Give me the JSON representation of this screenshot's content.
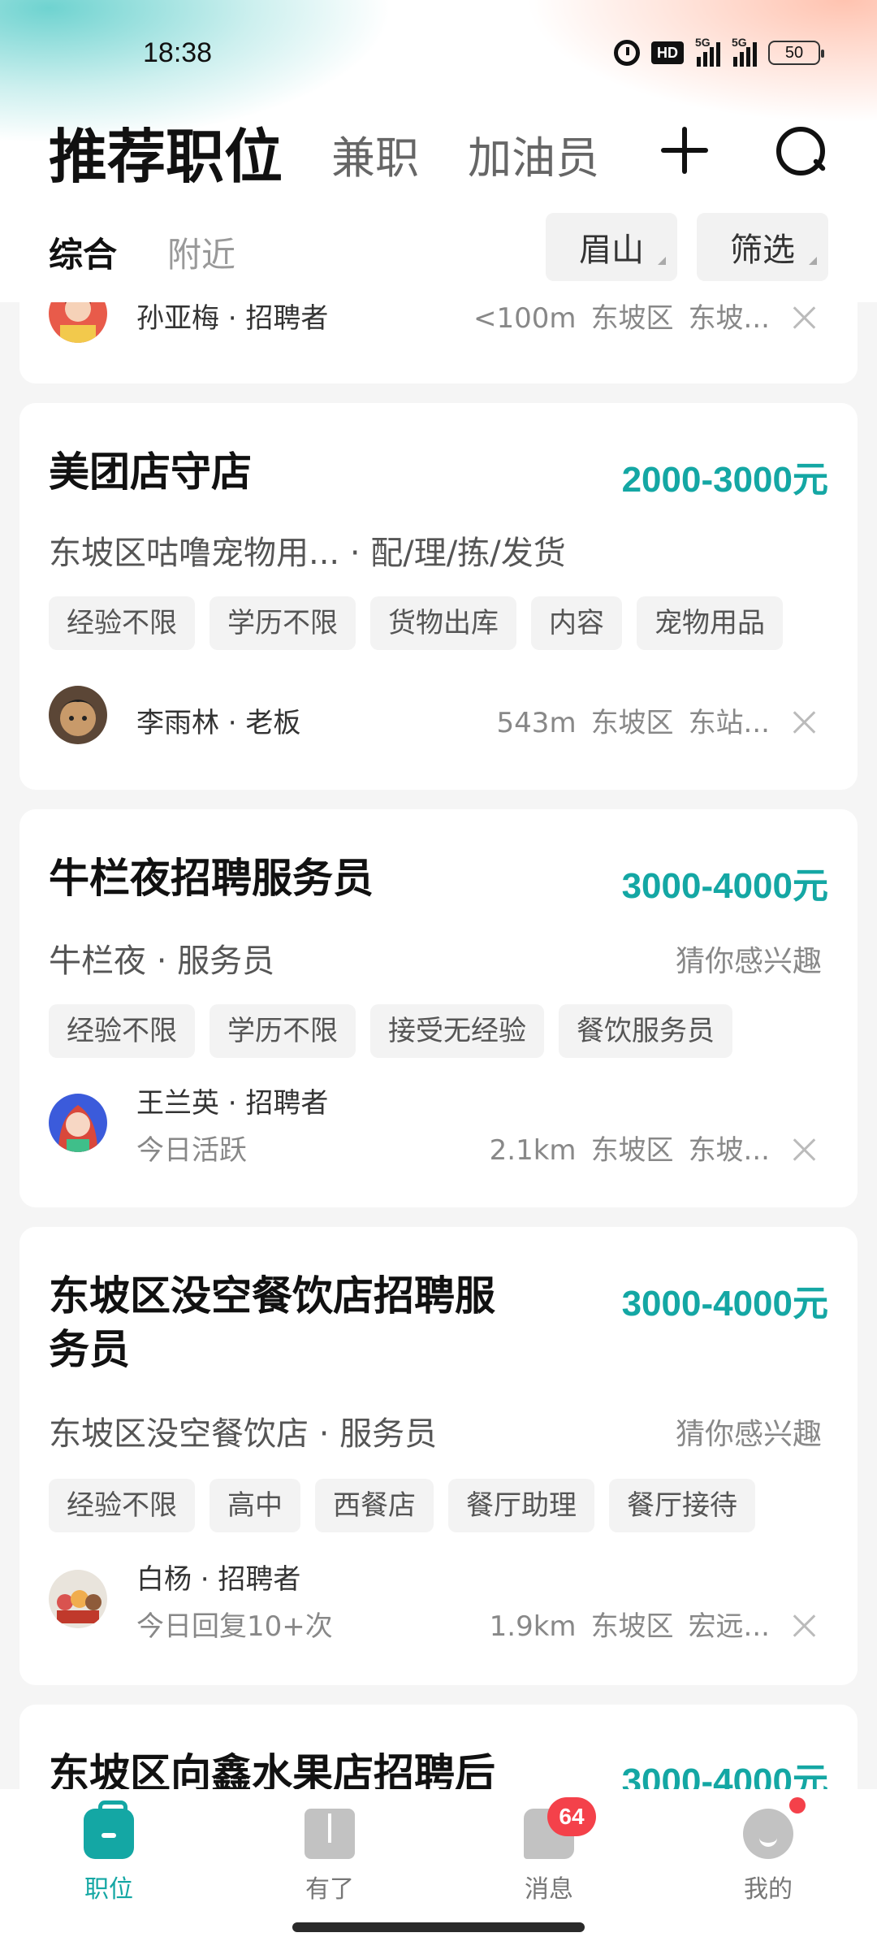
{
  "status_bar": {
    "time": "18:38",
    "icons": [
      "alarm-icon",
      "hd-icon",
      "signal-5g-icon",
      "signal-5g-icon",
      "battery-icon"
    ],
    "hd_label": "HD",
    "net_label": "5G",
    "battery": "50"
  },
  "header": {
    "title": "推荐职位",
    "tabs": [
      "兼职",
      "加油员"
    ],
    "add_icon": "plus-icon",
    "search_icon": "search-icon"
  },
  "filter_bar": {
    "sort_active": "综合",
    "sort_other": "附近",
    "city": "眉山",
    "filter": "筛选"
  },
  "jobs": [
    {
      "recruiter": "孙亚梅 · 招聘者",
      "distance": "<100m",
      "district": "东坡区",
      "area": "东坡..."
    },
    {
      "title": "美团店守店",
      "salary": "2000-3000元",
      "company": "东坡区咕噜宠物用... · 配/理/拣/发货",
      "tags": [
        "经验不限",
        "学历不限",
        "货物出库",
        "内容",
        "宠物用品"
      ],
      "recruiter": "李雨林 · 老板",
      "distance": "543m",
      "district": "东坡区",
      "area": "东站..."
    },
    {
      "title": "牛栏夜招聘服务员",
      "salary": "3000-4000元",
      "company": "牛栏夜 · 服务员",
      "hint": "猜你感兴趣",
      "tags": [
        "经验不限",
        "学历不限",
        "接受无经验",
        "餐饮服务员"
      ],
      "recruiter": "王兰英 · 招聘者",
      "activity": "今日活跃",
      "distance": "2.1km",
      "district": "东坡区",
      "area": "东坡..."
    },
    {
      "title_line1": "东坡区没空餐饮店招聘服",
      "title_line2": "务员",
      "salary": "3000-4000元",
      "company": "东坡区没空餐饮店 · 服务员",
      "hint": "猜你感兴趣",
      "tags": [
        "经验不限",
        "高中",
        "西餐店",
        "餐厅助理",
        "餐厅接待"
      ],
      "recruiter": "白杨 · 招聘者",
      "activity": "今日回复10+次",
      "distance": "1.9km",
      "district": "东坡区",
      "area": "宏远..."
    },
    {
      "title": "东坡区向鑫水果店招聘后",
      "salary": "3000-4000元"
    }
  ],
  "bottom_nav": [
    {
      "label": "职位",
      "icon": "briefcase-icon",
      "active": true
    },
    {
      "label": "有了",
      "icon": "book-icon"
    },
    {
      "label": "消息",
      "icon": "chat-icon",
      "badge": "64"
    },
    {
      "label": "我的",
      "icon": "profile-icon",
      "dot": true
    }
  ],
  "colors": {
    "accent": "#14a7a4",
    "badge": "#f4414a"
  }
}
